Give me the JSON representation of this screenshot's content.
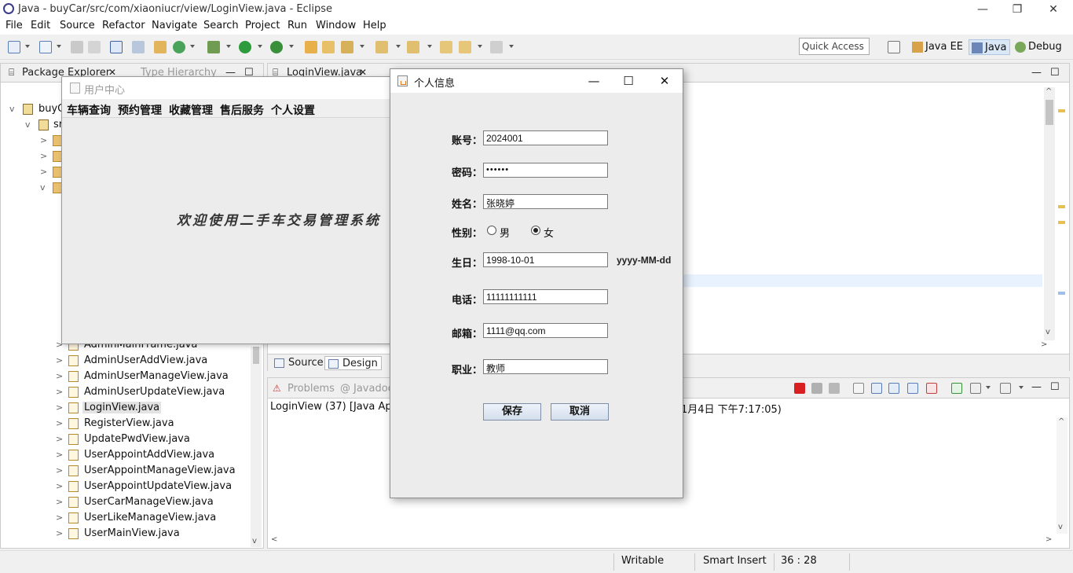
{
  "window": {
    "title": "Java - buyCar/src/com/xiaoniucr/view/LoginView.java - Eclipse",
    "controls": {
      "minimize": "—",
      "restore": "❐",
      "close": "✕"
    }
  },
  "menubar": [
    "File",
    "Edit",
    "Source",
    "Refactor",
    "Navigate",
    "Search",
    "Project",
    "Run",
    "Window",
    "Help"
  ],
  "toolbar": {
    "quick_access_placeholder": "Quick Access",
    "perspectives": [
      "Java EE",
      "Java",
      "Debug"
    ]
  },
  "package_explorer": {
    "tabs": [
      "Package Explorer",
      "Type Hierarchy"
    ],
    "project": "buyCar",
    "src_node": "src",
    "files": [
      "AdminMainFrame.java",
      "AdminUserAddView.java",
      "AdminUserManageView.java",
      "AdminUserUpdateView.java",
      "LoginView.java",
      "RegisterView.java",
      "UpdatePwdView.java",
      "UserAppointAddView.java",
      "UserAppointManageView.java",
      "UserAppointUpdateView.java",
      "UserCarManageView.java",
      "UserLikeManageView.java",
      "UserMainView.java"
    ],
    "selected_file": "LoginView.java"
  },
  "editor": {
    "tab": "LoginView.java",
    "bottom_tabs": [
      "Source",
      "Design"
    ]
  },
  "console": {
    "tabs": [
      "Problems",
      "Javadoc"
    ],
    "description": "LoginView (37) [Java Appli",
    "description_tail": "1月4日 下午7:17:05)"
  },
  "statusbar": {
    "writable": "Writable",
    "insert_mode": "Smart Insert",
    "position": "36 : 28"
  },
  "user_center": {
    "title": "用户中心",
    "menu": [
      "车辆查询",
      "预约管理",
      "收藏管理",
      "售后服务",
      "个人设置"
    ],
    "welcome": "欢迎使用二手车交易管理系统"
  },
  "dialog": {
    "title": "个人信息",
    "controls": {
      "minimize": "—",
      "maximize": "☐",
      "close": "✕"
    },
    "fields": {
      "account": {
        "label": "账号：",
        "value": "2024001"
      },
      "password": {
        "label": "密码：",
        "value": "••••••"
      },
      "name": {
        "label": "姓名：",
        "value": "张晓婷"
      },
      "gender": {
        "label": "性别：",
        "options": [
          "男",
          "女"
        ],
        "selected": "女"
      },
      "birthday": {
        "label": "生日：",
        "value": "1998-10-01",
        "hint": "yyyy-MM-dd"
      },
      "phone": {
        "label": "电话：",
        "value": "11111111111"
      },
      "email": {
        "label": "邮箱：",
        "value": "1111@qq.com"
      },
      "job": {
        "label": "职业：",
        "value": "教师"
      }
    },
    "buttons": {
      "save": "保存",
      "cancel": "取消"
    }
  },
  "colors": {
    "selection": "#e3e3e3",
    "active_perspective": "#d9e7f6",
    "line_highlight": "#e8f2fe"
  }
}
